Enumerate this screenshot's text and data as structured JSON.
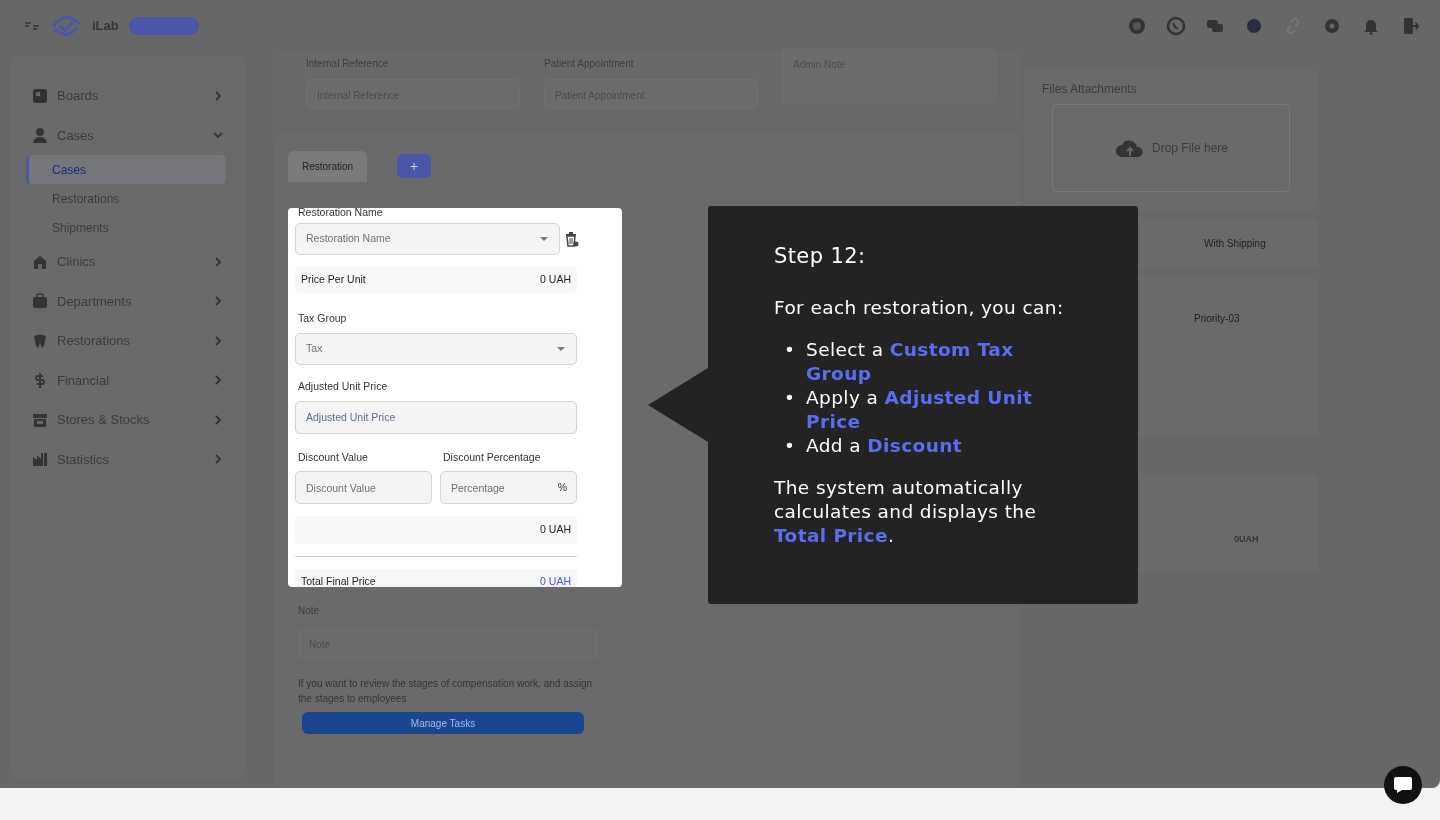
{
  "header": {
    "logo_text": "iLab"
  },
  "sidebar": {
    "items": [
      {
        "label": "Boards",
        "expanded": false
      },
      {
        "label": "Cases",
        "expanded": true,
        "children": [
          {
            "label": "Cases",
            "selected": true
          },
          {
            "label": "Restorations",
            "selected": false
          },
          {
            "label": "Shipments",
            "selected": false
          }
        ]
      },
      {
        "label": "Clinics",
        "expanded": false
      },
      {
        "label": "Departments",
        "expanded": false
      },
      {
        "label": "Restorations",
        "expanded": false
      },
      {
        "label": "Financial",
        "expanded": false
      },
      {
        "label": "Stores & Stocks",
        "expanded": false
      },
      {
        "label": "Statistics",
        "expanded": false
      }
    ]
  },
  "case_fields": [
    {
      "label": "Internal Reference",
      "placeholder": "Internal Reference"
    },
    {
      "label": "Patient Appointment",
      "placeholder": "Patient Appointment"
    }
  ],
  "admin_note": {
    "placeholder": "Admin Note"
  },
  "tabs": [
    {
      "label": "Restoration",
      "selected": true
    }
  ],
  "add_tab_button": "+",
  "restoration_form": {
    "name_label": "Restoration Name",
    "name_placeholder": "Restoration Name",
    "price_per_unit": {
      "label": "Price Per Unit",
      "value": "0 UAH"
    },
    "tax_group": {
      "label": "Tax Group",
      "placeholder": "Tax"
    },
    "adjusted_unit_price": {
      "label": "Adjusted Unit Price",
      "placeholder": "Adjusted Unit Price"
    },
    "discount_value": {
      "label": "Discount Value",
      "placeholder": "Discount Value"
    },
    "discount_percentage": {
      "label": "Discount Percentage",
      "placeholder": "Percentage",
      "suffix": "%"
    },
    "subtotal": "0 UAH",
    "total": {
      "label": "Total Final Price",
      "value": "0 UAH"
    }
  },
  "note": {
    "label": "Note",
    "placeholder": "Note"
  },
  "tasks_hint": "If you want to review the stages of compensation work, and assign the stages to employees",
  "manage_tasks_button": "Manage Tasks",
  "files": {
    "title": "Files Attachments",
    "drop_text": "Drop File here"
  },
  "shipment": {
    "option": "With Shipping"
  },
  "case_details": {
    "priority": "Priority-03"
  },
  "case_summary": {
    "value": "0UAH"
  },
  "tooltip": {
    "title": "Step 12:",
    "intro": "For each restoration, you can:",
    "bullets": [
      {
        "marker": "•",
        "text": "Select a **Custom Tax Group**"
      },
      {
        "marker": "•",
        "text": "Apply a **Adjusted Unit Price**"
      },
      {
        "marker": "•",
        "text": "Add a **Discount**"
      }
    ],
    "outro": "The system automatically calculates and displays the **Total Price**."
  }
}
